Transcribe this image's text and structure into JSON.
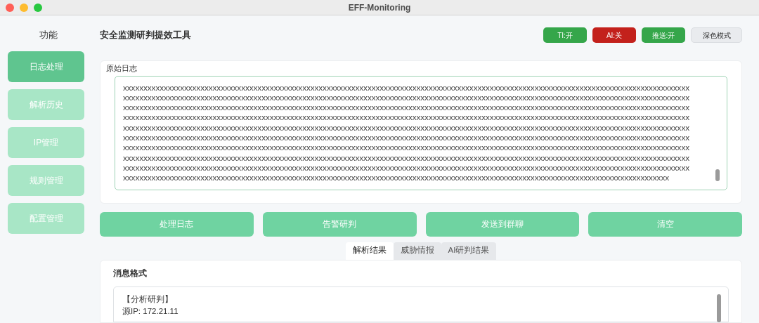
{
  "window": {
    "title": "EFF-Monitoring"
  },
  "sidebar": {
    "heading": "功能",
    "items": [
      {
        "label": "日志处理",
        "selected": true
      },
      {
        "label": "解析历史",
        "selected": false
      },
      {
        "label": "IP管理",
        "selected": false
      },
      {
        "label": "规则管理",
        "selected": false
      },
      {
        "label": "配置管理",
        "selected": false
      }
    ]
  },
  "header": {
    "title": "安全监测研判提效工具",
    "toggles": [
      {
        "label": "TI:开",
        "on": true
      },
      {
        "label": "AI:关",
        "on": false
      },
      {
        "label": "推送:开",
        "on": true
      }
    ],
    "theme_button": "深色模式"
  },
  "raw_log": {
    "label": "原始日志",
    "lines": [
      "xxxxxxxxxxxxxxxxxxxxxxxxxxxxxxxxxxxxxxxxxxxxxxxxxxxxxxxxxxxxxxxxxxxxxxxxxxxxxxxxxxxxxxxxxxxxxxxxxxxxxxxxxxxxxxxxxxxxxxxxxxxxxxxxxxxxxxxxxxx",
      "xxxxxxxxxxxxxxxxxxxxxxxxxxxxxxxxxxxxxxxxxxxxxxxxxxxxxxxxxxxxxxxxxxxxxxxxxxxxxxxxxxxxxxxxxxxxxxxxxxxxxxxxxxxxxxxxxxxxxxxxxxxxxxxxxxxxxxxxxxx",
      "xxxxxxxxxxxxxxxxxxxxxxxxxxxxxxxxxxxxxxxxxxxxxxxxxxxxxxxxxxxxxxxxxxxxxxxxxxxxxxxxxxxxxxxxxxxxxxxxxxxxxxxxxxxxxxxxxxxxxxxxxxxxxxxxxxxxxxxxxxx",
      "xxxxxxxxxxxxxxxxxxxxxxxxxxxxxxxxxxxxxxxxxxxxxxxxxxxxxxxxxxxxxxxxxxxxxxxxxxxxxxxxxxxxxxxxxxxxxxxxxxxxxxxxxxxxxxxxxxxxxxxxxxxxxxxxxxxxxxxxxxx",
      "xxxxxxxxxxxxxxxxxxxxxxxxxxxxxxxxxxxxxxxxxxxxxxxxxxxxxxxxxxxxxxxxxxxxxxxxxxxxxxxxxxxxxxxxxxxxxxxxxxxxxxxxxxxxxxxxxxxxxxxxxxxxxxxxxxxxxxxxxxx",
      "xxxxxxxxxxxxxxxxxxxxxxxxxxxxxxxxxxxxxxxxxxxxxxxxxxxxxxxxxxxxxxxxxxxxxxxxxxxxxxxxxxxxxxxxxxxxxxxxxxxxxxxxxxxxxxxxxxxxxxxxxxxxxxxxxxxxxxxxxxx",
      "xxxxxxxxxxxxxxxxxxxxxxxxxxxxxxxxxxxxxxxxxxxxxxxxxxxxxxxxxxxxxxxxxxxxxxxxxxxxxxxxxxxxxxxxxxxxxxxxxxxxxxxxxxxxxxxxxxxxxxxxxxxxxxxxxxxxxxxxxxx",
      "xxxxxxxxxxxxxxxxxxxxxxxxxxxxxxxxxxxxxxxxxxxxxxxxxxxxxxxxxxxxxxxxxxxxxxxxxxxxxxxxxxxxxxxxxxxxxxxxxxxxxxxxxxxxxxxxxxxxxxxxxxxxxxxxxxxxxxxxxxx",
      "xxxxxxxxxxxxxxxxxxxxxxxxxxxxxxxxxxxxxxxxxxxxxxxxxxxxxxxxxxxxxxxxxxxxxxxxxxxxxxxxxxxxxxxxxxxxxxxxxxxxxxxxxxxxxxxxxxxxxxxxxxxxxxxxxxxxxxxxxxx",
      "xxxxxxxxxxxxxxxxxxxxxxxxxxxxxxxxxxxxxxxxxxxxxxxxxxxxxxxxxxxxxxxxxxxxxxxxxxxxxxxxxxxxxxxxxxxxxxxxxxxxxxxxxxxxxxxxxxxxxxxxxxxxxxxxxxxxxx"
    ]
  },
  "actions": [
    "处理日志",
    "告警研判",
    "发送到群聊",
    "清空"
  ],
  "result_tabs": [
    {
      "label": "解析结果",
      "selected": true
    },
    {
      "label": "威胁情报",
      "selected": false
    },
    {
      "label": "AI研判结果",
      "selected": false
    }
  ],
  "result": {
    "label": "消息格式",
    "lines": [
      "【分析研判】",
      "源IP: 172.21.11"
    ]
  }
}
